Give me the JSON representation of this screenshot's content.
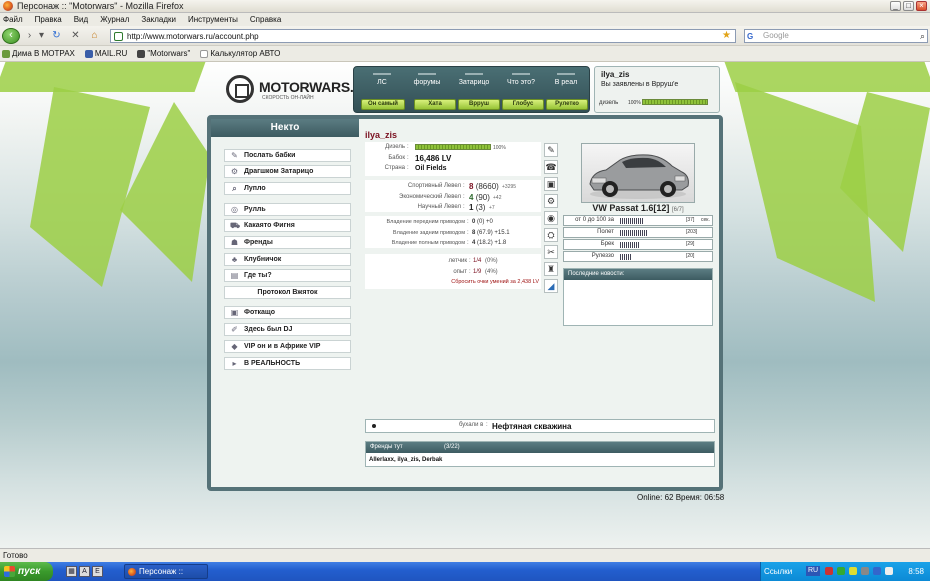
{
  "window": {
    "title": "Персонаж :: \"Motorwars\" - Mozilla Firefox",
    "menu": [
      "Файл",
      "Правка",
      "Вид",
      "Журнал",
      "Закладки",
      "Инструменты",
      "Справка"
    ],
    "url": "http://www.motorwars.ru/account.php",
    "search_placeholder": "Google",
    "bookmarks": [
      "Дима В МОТРАХ",
      "MAIL.RU",
      "\"Motorwars\"",
      "Калькулятор АВТО"
    ],
    "status": "Готово"
  },
  "site": {
    "logo_name": "MOTORWARS.RU",
    "logo_slogan": "СКОРОСТЬ ОН-ЛАЙН",
    "topnav": [
      "ЛС",
      "форумы",
      "Затарицо",
      "Что это?",
      "В реал"
    ],
    "greenbuttons": [
      "Он самый",
      "Хата",
      "Врруш",
      "Глобус",
      "Рулетко"
    ],
    "user": {
      "name": "ilya_zis",
      "text": "Вы заявлены в Врруш'е",
      "diesel_label": "дизель",
      "diesel_pct": "100%",
      "diesel_fill": 1.0
    }
  },
  "leftpanel": {
    "title": "Некто",
    "items": [
      "Послать бабки",
      "Драгшком Затарицо",
      "Лупло",
      "Рулль",
      "Какаято Фигня",
      "Френды",
      "Клубничок",
      "Где ты?",
      "Протокол Вжяток",
      "Фоткащо",
      "Здесь был DJ",
      "VIP он и в Африке VIP",
      "В РЕАЛЬНОСТЬ"
    ]
  },
  "profile": {
    "name": "ilya_zis",
    "diesel_label": "Дизель",
    "diesel_pct": "100%",
    "diesel_fill": 1.0,
    "money_label": "Бабок",
    "money_value": "16,486 LV",
    "country_label": "Страна",
    "country_value": "Oil Fields",
    "levels": [
      {
        "label": "Спортивный Левел",
        "level": "8",
        "points": "(8660)",
        "delta": "+3295"
      },
      {
        "label": "Экономический Левел",
        "level": "4",
        "points": "(90)",
        "delta": "+42"
      },
      {
        "label": "Научный Левел",
        "level": "1",
        "points": "(3)",
        "delta": "+7"
      }
    ],
    "drives": [
      {
        "label": "Владение передним приводом",
        "value": "0",
        "points": "(0)",
        "delta": "+0"
      },
      {
        "label": "Владение задним приводом",
        "value": "8",
        "points": "(67.9)",
        "delta": "+15.1"
      },
      {
        "label": "Владение полным приводом",
        "value": "4",
        "points": "(18.2)",
        "delta": "+1.8"
      }
    ],
    "pilot_label": "летчик",
    "pilot_value": "1/4",
    "pilot_pct": "(0%)",
    "exp_label": "опыт",
    "exp_value": "1/9",
    "exp_pct": "(4%)",
    "reset_link": "Сбросить очки умений за 2,438 LV"
  },
  "car": {
    "name": "VW Passat 1.6[12]",
    "extra": "[6/7]",
    "stats": [
      {
        "label": "от 0 до 100 за",
        "value": "[37]",
        "unit": "сек.",
        "fill": 0.37
      },
      {
        "label": "Полет",
        "value": "[203]",
        "unit": "",
        "fill": 0.43
      },
      {
        "label": "Брек",
        "value": "[29]",
        "unit": "",
        "fill": 0.33
      },
      {
        "label": "Рулеззо",
        "value": "[20]",
        "unit": "",
        "fill": 0.18
      }
    ]
  },
  "news": {
    "title": "Последние новости:"
  },
  "business": {
    "label": "бухали в",
    "value": "Нефтяная скважина"
  },
  "friends": {
    "title": "Френды тут",
    "count": "(3/22)",
    "list": "Allerlaxx, ilya_zis, Derbak"
  },
  "online": "Online: 62  Время: 06:58",
  "taskbar": {
    "start": "пуск",
    "task": "Персонаж :: \"Motorn...",
    "links": "Ссылки",
    "lang": "RU",
    "clock": "8:58"
  }
}
